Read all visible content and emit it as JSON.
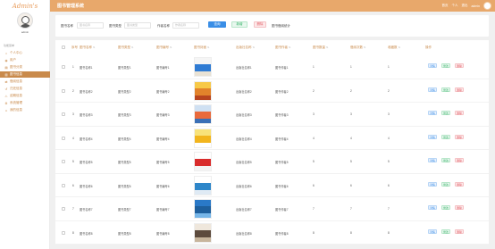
{
  "app": {
    "logo_text": "Admin's",
    "username": "admin",
    "nav_section": "功能菜单",
    "page_title": "图书管理系统"
  },
  "sidebar": {
    "items": [
      {
        "label": "个人中心",
        "icon": "home-icon",
        "active": false
      },
      {
        "label": "用户",
        "icon": "user-icon",
        "active": false
      },
      {
        "label": "图书分类",
        "icon": "category-icon",
        "active": false
      },
      {
        "label": "图书信息",
        "icon": "book-icon",
        "active": true
      },
      {
        "label": "借阅信息",
        "icon": "borrow-icon",
        "active": false
      },
      {
        "label": "归还信息",
        "icon": "return-icon",
        "active": false
      },
      {
        "label": "逾期信息",
        "icon": "overdue-icon",
        "active": false
      },
      {
        "label": "系统管理",
        "icon": "settings-icon",
        "active": false
      },
      {
        "label": "我的信息",
        "icon": "profile-icon",
        "active": false
      }
    ]
  },
  "header": {
    "links": [
      "首页",
      "个人",
      "退出",
      "admin"
    ]
  },
  "search": {
    "label_1": "图书名称",
    "placeholder_1": "图书名称",
    "label_2": "图书类型",
    "placeholder_2": "图书类型",
    "label_3": "作者名称",
    "placeholder_3": "作者名称",
    "search_label": "查询",
    "add_label": "新增",
    "delete_label": "删除",
    "stat_label": "图书借阅统计"
  },
  "table": {
    "columns": [
      "序号",
      "图书名称",
      "图书类型",
      "图书编号",
      "图书封面",
      "出版社名称",
      "图书作者",
      "图书数量",
      "借阅次数",
      "收藏数",
      "操作"
    ],
    "actions": {
      "detail": "详情",
      "edit": "修改",
      "delete": "删除"
    },
    "rows": [
      {
        "index": "1",
        "name": "图书名称1",
        "type": "图书类型1",
        "code": "图书编号1",
        "publisher": "出版社名称1",
        "author": "图书作者1",
        "qty": "1",
        "borrows": "1",
        "favs": "1",
        "cover_colors": [
          "#f5f5f5",
          "#2f7bd3",
          "#e9e2d4"
        ]
      },
      {
        "index": "2",
        "name": "图书名称2",
        "type": "图书类型2",
        "code": "图书编号2",
        "publisher": "出版社名称2",
        "author": "图书作者2",
        "qty": "2",
        "borrows": "2",
        "favs": "2",
        "cover_colors": [
          "#f7c948",
          "#e2832b",
          "#b8451f"
        ]
      },
      {
        "index": "3",
        "name": "图书名称3",
        "type": "图书类型3",
        "code": "图书编号3",
        "publisher": "出版社名称3",
        "author": "图书作者3",
        "qty": "3",
        "borrows": "3",
        "favs": "3",
        "cover_colors": [
          "#cfe0f2",
          "#e96a3c",
          "#3a6fb6"
        ]
      },
      {
        "index": "4",
        "name": "图书名称4",
        "type": "图书类型4",
        "code": "图书编号4",
        "publisher": "出版社名称4",
        "author": "图书作者4",
        "qty": "4",
        "borrows": "4",
        "favs": "4",
        "cover_colors": [
          "#f8e27a",
          "#f2b51d",
          "#ffffff"
        ]
      },
      {
        "index": "5",
        "name": "图书名称5",
        "type": "图书类型5",
        "code": "图书编号5",
        "publisher": "出版社名称5",
        "author": "图书作者5",
        "qty": "5",
        "borrows": "5",
        "favs": "5",
        "cover_colors": [
          "#ffffff",
          "#d92c2c",
          "#f4f4f4"
        ]
      },
      {
        "index": "6",
        "name": "图书名称6",
        "type": "图书类型6",
        "code": "图书编号6",
        "publisher": "出版社名称6",
        "author": "图书作者6",
        "qty": "6",
        "borrows": "6",
        "favs": "6",
        "cover_colors": [
          "#ffffff",
          "#2e86c9",
          "#dfeaf4"
        ]
      },
      {
        "index": "7",
        "name": "图书名称7",
        "type": "图书类型7",
        "code": "图书编号7",
        "publisher": "出版社名称7",
        "author": "图书作者7",
        "qty": "7",
        "borrows": "7",
        "favs": "7",
        "cover_colors": [
          "#2a79c7",
          "#1e5f9c",
          "#77b6e8"
        ]
      },
      {
        "index": "8",
        "name": "图书名称8",
        "type": "图书类型8",
        "code": "图书编号8",
        "publisher": "出版社名称8",
        "author": "图书作者8",
        "qty": "8",
        "borrows": "8",
        "favs": "8",
        "cover_colors": [
          "#efe7dc",
          "#5d4b3d",
          "#c7b59c"
        ]
      }
    ]
  },
  "colors": {
    "accent": "#e8a86b",
    "nav_active": "#c98a4b",
    "primary": "#3a8ee6",
    "success": "#38b36a",
    "danger": "#e05b63"
  }
}
